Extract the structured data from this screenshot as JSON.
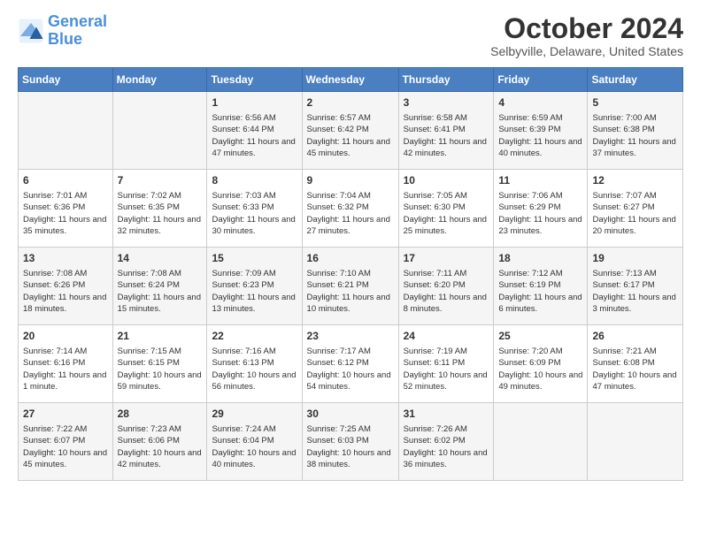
{
  "header": {
    "logo_line1": "General",
    "logo_line2": "Blue",
    "title": "October 2024",
    "subtitle": "Selbyville, Delaware, United States"
  },
  "days_of_week": [
    "Sunday",
    "Monday",
    "Tuesday",
    "Wednesday",
    "Thursday",
    "Friday",
    "Saturday"
  ],
  "weeks": [
    [
      {
        "day": "",
        "info": ""
      },
      {
        "day": "",
        "info": ""
      },
      {
        "day": "1",
        "info": "Sunrise: 6:56 AM\nSunset: 6:44 PM\nDaylight: 11 hours and 47 minutes."
      },
      {
        "day": "2",
        "info": "Sunrise: 6:57 AM\nSunset: 6:42 PM\nDaylight: 11 hours and 45 minutes."
      },
      {
        "day": "3",
        "info": "Sunrise: 6:58 AM\nSunset: 6:41 PM\nDaylight: 11 hours and 42 minutes."
      },
      {
        "day": "4",
        "info": "Sunrise: 6:59 AM\nSunset: 6:39 PM\nDaylight: 11 hours and 40 minutes."
      },
      {
        "day": "5",
        "info": "Sunrise: 7:00 AM\nSunset: 6:38 PM\nDaylight: 11 hours and 37 minutes."
      }
    ],
    [
      {
        "day": "6",
        "info": "Sunrise: 7:01 AM\nSunset: 6:36 PM\nDaylight: 11 hours and 35 minutes."
      },
      {
        "day": "7",
        "info": "Sunrise: 7:02 AM\nSunset: 6:35 PM\nDaylight: 11 hours and 32 minutes."
      },
      {
        "day": "8",
        "info": "Sunrise: 7:03 AM\nSunset: 6:33 PM\nDaylight: 11 hours and 30 minutes."
      },
      {
        "day": "9",
        "info": "Sunrise: 7:04 AM\nSunset: 6:32 PM\nDaylight: 11 hours and 27 minutes."
      },
      {
        "day": "10",
        "info": "Sunrise: 7:05 AM\nSunset: 6:30 PM\nDaylight: 11 hours and 25 minutes."
      },
      {
        "day": "11",
        "info": "Sunrise: 7:06 AM\nSunset: 6:29 PM\nDaylight: 11 hours and 23 minutes."
      },
      {
        "day": "12",
        "info": "Sunrise: 7:07 AM\nSunset: 6:27 PM\nDaylight: 11 hours and 20 minutes."
      }
    ],
    [
      {
        "day": "13",
        "info": "Sunrise: 7:08 AM\nSunset: 6:26 PM\nDaylight: 11 hours and 18 minutes."
      },
      {
        "day": "14",
        "info": "Sunrise: 7:08 AM\nSunset: 6:24 PM\nDaylight: 11 hours and 15 minutes."
      },
      {
        "day": "15",
        "info": "Sunrise: 7:09 AM\nSunset: 6:23 PM\nDaylight: 11 hours and 13 minutes."
      },
      {
        "day": "16",
        "info": "Sunrise: 7:10 AM\nSunset: 6:21 PM\nDaylight: 11 hours and 10 minutes."
      },
      {
        "day": "17",
        "info": "Sunrise: 7:11 AM\nSunset: 6:20 PM\nDaylight: 11 hours and 8 minutes."
      },
      {
        "day": "18",
        "info": "Sunrise: 7:12 AM\nSunset: 6:19 PM\nDaylight: 11 hours and 6 minutes."
      },
      {
        "day": "19",
        "info": "Sunrise: 7:13 AM\nSunset: 6:17 PM\nDaylight: 11 hours and 3 minutes."
      }
    ],
    [
      {
        "day": "20",
        "info": "Sunrise: 7:14 AM\nSunset: 6:16 PM\nDaylight: 11 hours and 1 minute."
      },
      {
        "day": "21",
        "info": "Sunrise: 7:15 AM\nSunset: 6:15 PM\nDaylight: 10 hours and 59 minutes."
      },
      {
        "day": "22",
        "info": "Sunrise: 7:16 AM\nSunset: 6:13 PM\nDaylight: 10 hours and 56 minutes."
      },
      {
        "day": "23",
        "info": "Sunrise: 7:17 AM\nSunset: 6:12 PM\nDaylight: 10 hours and 54 minutes."
      },
      {
        "day": "24",
        "info": "Sunrise: 7:19 AM\nSunset: 6:11 PM\nDaylight: 10 hours and 52 minutes."
      },
      {
        "day": "25",
        "info": "Sunrise: 7:20 AM\nSunset: 6:09 PM\nDaylight: 10 hours and 49 minutes."
      },
      {
        "day": "26",
        "info": "Sunrise: 7:21 AM\nSunset: 6:08 PM\nDaylight: 10 hours and 47 minutes."
      }
    ],
    [
      {
        "day": "27",
        "info": "Sunrise: 7:22 AM\nSunset: 6:07 PM\nDaylight: 10 hours and 45 minutes."
      },
      {
        "day": "28",
        "info": "Sunrise: 7:23 AM\nSunset: 6:06 PM\nDaylight: 10 hours and 42 minutes."
      },
      {
        "day": "29",
        "info": "Sunrise: 7:24 AM\nSunset: 6:04 PM\nDaylight: 10 hours and 40 minutes."
      },
      {
        "day": "30",
        "info": "Sunrise: 7:25 AM\nSunset: 6:03 PM\nDaylight: 10 hours and 38 minutes."
      },
      {
        "day": "31",
        "info": "Sunrise: 7:26 AM\nSunset: 6:02 PM\nDaylight: 10 hours and 36 minutes."
      },
      {
        "day": "",
        "info": ""
      },
      {
        "day": "",
        "info": ""
      }
    ]
  ]
}
